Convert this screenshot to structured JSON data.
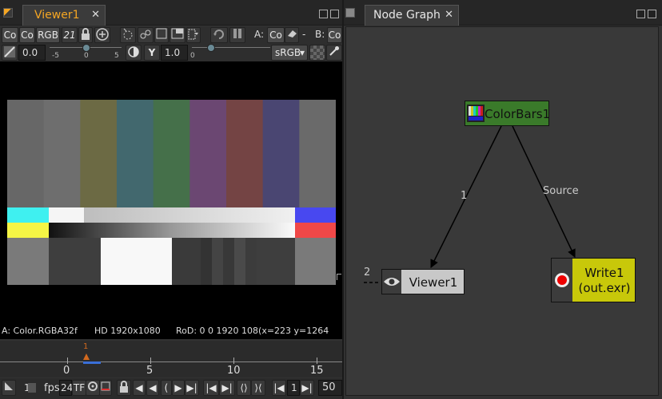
{
  "viewer_pane": {
    "tab_label": "Viewer1",
    "toolbar_row1": {
      "channels_a": "Co",
      "channels_b": "Co",
      "channel_mode": "RGB",
      "frame_range": "21",
      "a_label": "A:",
      "a_value": "Co",
      "dash": "-",
      "b_label": "B:",
      "b_value": "Co"
    },
    "toolbar_row2": {
      "gain_value": "0.0",
      "gain_ticks": [
        "-5",
        "0",
        "5"
      ],
      "gamma_value": "1.0",
      "gamma_tick": "0",
      "colorspace": "sRGB"
    },
    "status": {
      "layer": "A: Color.RGBA32f",
      "format": "HD 1920x1080",
      "rod": "RoD: 0 0 1920 108(x=223 y=1264"
    },
    "timeline": {
      "ticks": [
        "0",
        "5",
        "10",
        "15"
      ],
      "current_frame_marker": "1"
    },
    "playbar": {
      "frame": "1",
      "fps_label": "fps",
      "fps_value": "24",
      "tf_label": "TF",
      "frame_field": "1",
      "end_frame": "50"
    }
  },
  "graph_pane": {
    "tab_label": "Node Graph",
    "nodes": {
      "colorbars": {
        "label": "ColorBars1",
        "color": "#3a7a2a"
      },
      "viewer": {
        "label": "Viewer1",
        "input_number": "2",
        "color": "#c8c8c8"
      },
      "write": {
        "label_line1": "Write1",
        "label_line2": "(out.exr)",
        "color": "#c8c80a"
      }
    },
    "edges": {
      "viewer_input": "1",
      "write_input": "Source"
    }
  },
  "colors": {
    "accent_orange": "#f5a623",
    "bar_top": [
      "#676767",
      "#6e6e6e",
      "#6c6a44",
      "#42686e",
      "#45704a",
      "#6b4772",
      "#744444",
      "#4a4672",
      "#6a6a6a"
    ]
  }
}
